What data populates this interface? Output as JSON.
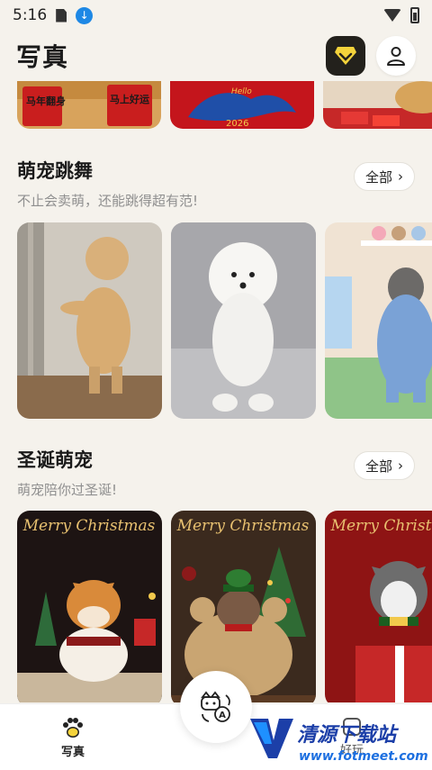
{
  "status_bar": {
    "time": "5:16"
  },
  "header": {
    "title": "写真"
  },
  "sections": [
    {
      "title": "萌宠跳舞",
      "subtitle": "不止会卖萌，还能跳得超有范!",
      "all_label": "全部",
      "cards": [
        "golden-retriever-dancing",
        "white-poodle-standing",
        "husky-in-blue-outfit"
      ]
    },
    {
      "title": "圣诞萌宠",
      "subtitle": "萌宠陪你过圣诞!",
      "all_label": "全部",
      "cards": [
        {
          "caption": "Merry Christmas"
        },
        {
          "caption": "Merry Christmas"
        },
        {
          "caption": "Merry Christmas"
        }
      ]
    }
  ],
  "top_strip": [
    "dog-with-red-banners",
    "blue-horse-2026-card",
    "puppy-with-red-envelopes"
  ],
  "top_strip_text": {
    "banner_1": "马年翻身",
    "banner_2": "马上好运",
    "horse_text": "Hello",
    "horse_year": "2026"
  },
  "bottom_nav": {
    "photo_label": "写真",
    "play_label": "好玩"
  },
  "watermark": {
    "brand": "清源下载站",
    "url": "www.fotmeet.com"
  },
  "colors": {
    "background": "#f5f2ec",
    "accent_gold": "#f4d33b",
    "vip_bg": "#23211c"
  }
}
